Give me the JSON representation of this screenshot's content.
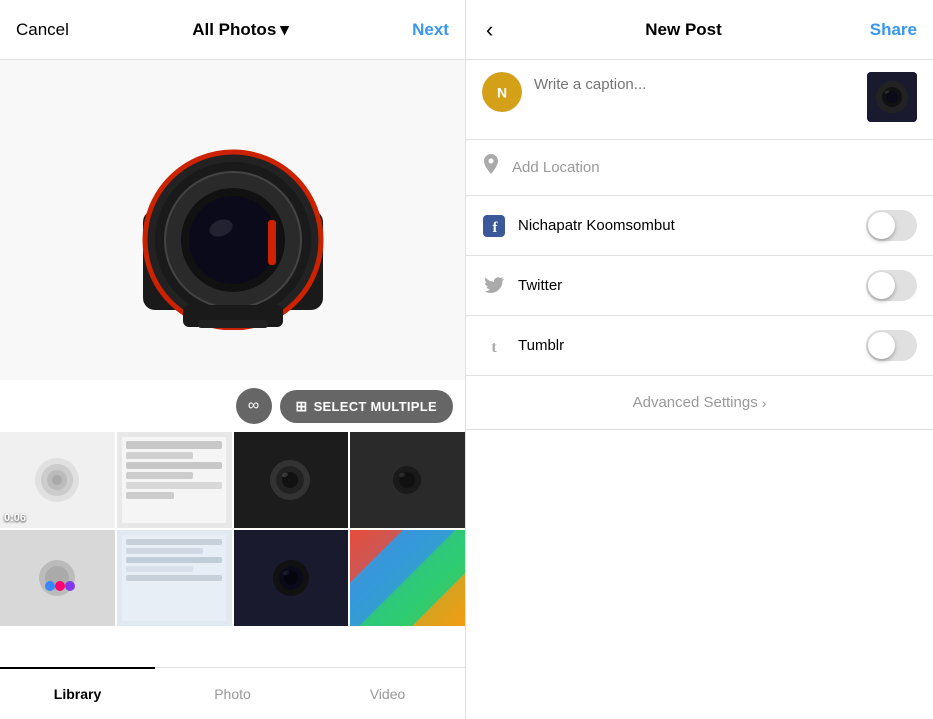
{
  "left": {
    "cancel_label": "Cancel",
    "all_photos_label": "All Photos",
    "next_label": "Next",
    "toolbar": {
      "infinity_symbol": "∞",
      "select_multiple_label": "SELECT MULTIPLE"
    },
    "tabs": [
      {
        "id": "library",
        "label": "Library",
        "active": true
      },
      {
        "id": "photo",
        "label": "Photo",
        "active": false
      },
      {
        "id": "video",
        "label": "Video",
        "active": false
      }
    ],
    "thumbnail_duration": "0:06"
  },
  "right": {
    "back_icon": "‹",
    "title": "New Post",
    "share_label": "Share",
    "caption_placeholder": "Write a caption...",
    "location_placeholder": "Add Location",
    "social_accounts": [
      {
        "id": "facebook",
        "label": "Nichapatr Koomsombut",
        "platform": "facebook",
        "enabled": false
      },
      {
        "id": "twitter",
        "label": "Twitter",
        "platform": "twitter",
        "enabled": false
      },
      {
        "id": "tumblr",
        "label": "Tumblr",
        "platform": "tumblr",
        "enabled": false
      }
    ],
    "advanced_settings_label": "Advanced Settings",
    "advanced_chevron": "›"
  }
}
